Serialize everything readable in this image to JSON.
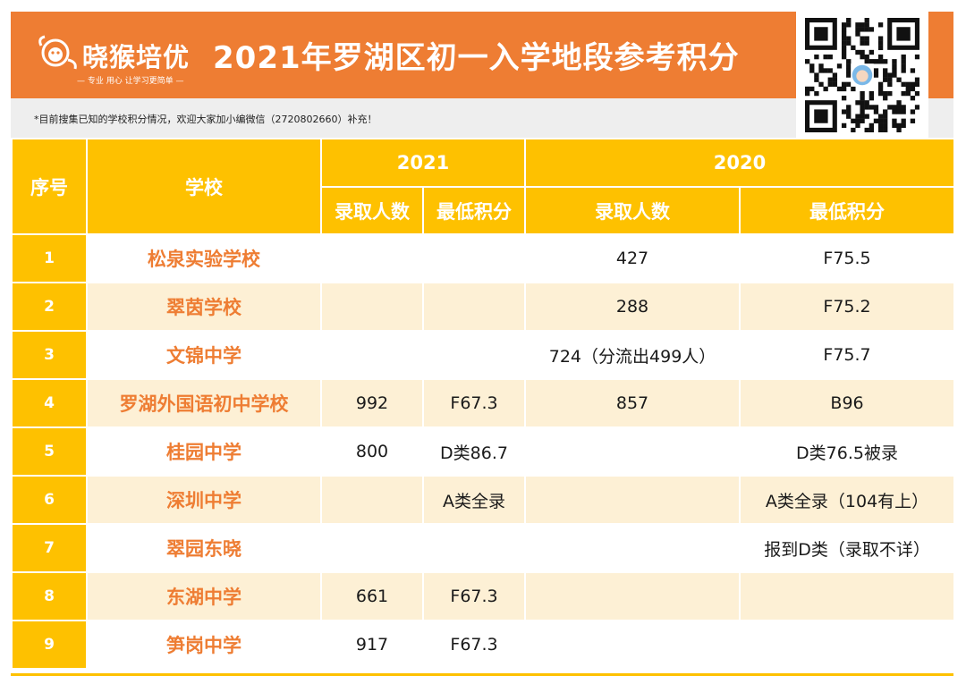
{
  "header": {
    "brand_name": "晓猴培优",
    "brand_slogan": "— 专业  用心  让学习更简单 —",
    "title": "2021年罗湖区初一入学地段参考积分",
    "notice": "*目前搜集已知的学校积分情况，欢迎大家加小编微信（2720802660）补充！"
  },
  "colors": {
    "orange": "#ee7d33",
    "yellow": "#fec100",
    "stripe": "#fdf0d5",
    "notice_bg": "#eeeeee"
  },
  "table": {
    "col_index": "序号",
    "col_school": "学校",
    "year_2021": "2021",
    "year_2020": "2020",
    "col_admitted_2021": "录取人数",
    "col_min_score_2021": "最低积分",
    "col_admitted_2020": "录取人数",
    "col_min_score_2020": "最低积分",
    "rows": [
      {
        "no": "1",
        "school": "松泉实验学校",
        "a21": "",
        "s21": "",
        "a20": "427",
        "s20": "F75.5"
      },
      {
        "no": "2",
        "school": "翠茵学校",
        "a21": "",
        "s21": "",
        "a20": "288",
        "s20": "F75.2"
      },
      {
        "no": "3",
        "school": "文锦中学",
        "a21": "",
        "s21": "",
        "a20": "724（分流出499人）",
        "s20": "F75.7"
      },
      {
        "no": "4",
        "school": "罗湖外国语初中学校",
        "a21": "992",
        "s21": "F67.3",
        "a20": "857",
        "s20": "B96"
      },
      {
        "no": "5",
        "school": "桂园中学",
        "a21": "800",
        "s21": "D类86.7",
        "a20": "",
        "s20": "D类76.5被录"
      },
      {
        "no": "6",
        "school": "深圳中学",
        "a21": "",
        "s21": "A类全录",
        "a20": "",
        "s20": "A类全录（104有上）"
      },
      {
        "no": "7",
        "school": "翠园东晓",
        "a21": "",
        "s21": "",
        "a20": "",
        "s20": "报到D类（录取不详）"
      },
      {
        "no": "8",
        "school": "东湖中学",
        "a21": "661",
        "s21": "F67.3",
        "a20": "",
        "s20": ""
      },
      {
        "no": "9",
        "school": "笋岗中学",
        "a21": "917",
        "s21": "F67.3",
        "a20": "",
        "s20": ""
      }
    ]
  }
}
